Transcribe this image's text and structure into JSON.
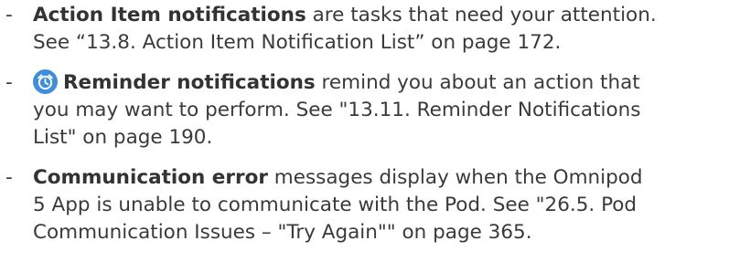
{
  "items": [
    {
      "bullet": "-",
      "lines": [
        {
          "bold": "Action Item notifications",
          "text": " are tasks that need your attention."
        },
        {
          "text": "See “13.8. Action Item Notification List” on page 172."
        }
      ]
    },
    {
      "bullet": "-",
      "icon": "alarm-clock-icon",
      "lines": [
        {
          "bold": "Reminder notifications",
          "text": " remind you about an action that"
        },
        {
          "text": "you may want to perform. See \"13.11. Reminder Notifications"
        },
        {
          "text": "List\" on page 190."
        }
      ]
    },
    {
      "bullet": "-",
      "lines": [
        {
          "bold": "Communication error",
          "text": " messages display when the Omnipod"
        },
        {
          "text": "5 App is unable to communicate with the Pod. See \"26.5. Pod"
        },
        {
          "text": "Communication Issues – \"Try Again\"\" on page 365."
        }
      ]
    }
  ],
  "colors": {
    "text": "#3a3a3a",
    "icon_bg": "#3d8fdc"
  }
}
